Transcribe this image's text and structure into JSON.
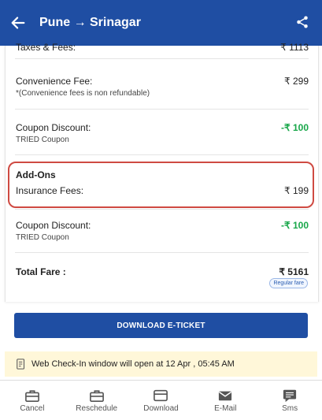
{
  "header": {
    "route": "Pune → Srinagar"
  },
  "rows": [
    {
      "label": "Taxes & Fees:",
      "amount": "₹ 1113"
    },
    {
      "label": "Convenience Fee:",
      "note": "*(Convenience fees is non refundable)",
      "amount": "₹ 299"
    },
    {
      "label": "Coupon Discount:",
      "note": "TRIED Coupon",
      "amount": "-₹ 100"
    }
  ],
  "addons": {
    "title": "Add-Ons",
    "label": "Insurance Fees:",
    "amount": "₹ 199"
  },
  "coupon2": {
    "label": "Coupon Discount:",
    "note": "TRIED Coupon",
    "amount": "-₹ 100"
  },
  "total": {
    "label": "Total Fare :",
    "amount": "₹ 5161",
    "badge": "Regular fare"
  },
  "download_button": "DOWNLOAD E-TICKET",
  "notice": "Web Check-In window will open at 12 Apr , 05:45 AM",
  "bottom_nav": [
    "Cancel",
    "Reschedule",
    "Download",
    "E-Mail",
    "Sms"
  ],
  "colors": {
    "primary": "#1f4ea3",
    "discount": "#19a74a",
    "highlight": "#cf4a42",
    "notice_bg": "#fff7d9"
  }
}
